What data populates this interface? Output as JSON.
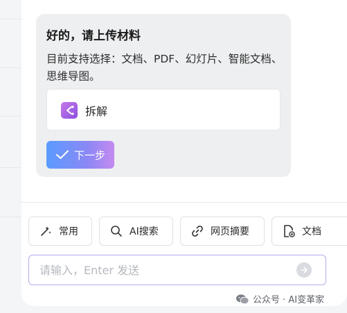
{
  "message_card": {
    "title": "好的，请上传材料",
    "description": "目前支持选择：文档、PDF、幻灯片、智能文档、思维导图。",
    "option_label": "拆解",
    "next_button_label": "下一步"
  },
  "tools": [
    {
      "label": "常用",
      "icon": "magic-wand-icon"
    },
    {
      "label": "AI搜索",
      "icon": "search-icon"
    },
    {
      "label": "网页摘要",
      "icon": "link-icon"
    },
    {
      "label": "文档",
      "icon": "document-add-icon"
    }
  ],
  "input": {
    "placeholder": "请输入，Enter 发送"
  },
  "watermark": {
    "text": "公众号 · AI变革家"
  },
  "colors": {
    "card_bg": "#eeeff1",
    "button_gradient_start": "#5b9bff",
    "button_gradient_end": "#c48af0",
    "option_icon": "#a45ee8",
    "input_border": "#b6a9ec"
  }
}
